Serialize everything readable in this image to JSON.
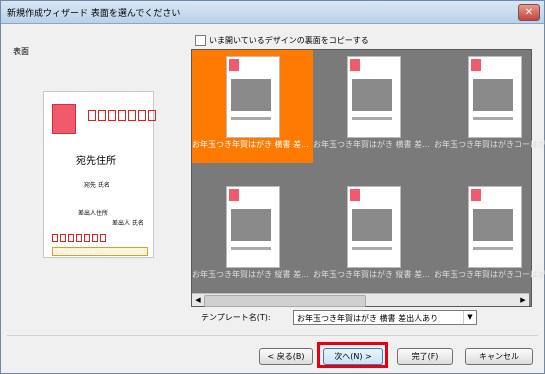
{
  "window": {
    "title": "新規作成ウィザード 表面を選んでください",
    "close_symbol": "✕"
  },
  "options": {
    "copy_open_design_label": "いま開いているデザインの裏面をコピーする"
  },
  "side_label": "表面",
  "preview": {
    "address": "宛先住所",
    "name": "宛先 氏名",
    "sender_address": "差出人住所",
    "sender_name": "差出人 氏名"
  },
  "templates": [
    {
      "label": "お年玉つき年賀はがき 横書 差..."
    },
    {
      "label": "お年玉つき年賀はがき 横書 差..."
    },
    {
      "label": "お年玉つき年賀はがきコーはが..."
    },
    {
      "label": "お年玉つき年賀はがき 縦書 差..."
    },
    {
      "label": "お年玉つき年賀はがき 縦書 差..."
    },
    {
      "label": "お年玉つき年賀はがきコーはが..."
    }
  ],
  "selected_template_index": 0,
  "template_name": {
    "label": "テンプレート名(T):",
    "value": "お年玉つき年賀はがき 横書 差出人あり"
  },
  "buttons": {
    "back": "< 戻る(B)",
    "next": "次へ(N) >",
    "finish": "完了(F)",
    "cancel": "キャンセル"
  },
  "colors": {
    "selected": "#ff7a00",
    "highlight": "#e60012",
    "stamp_red": "#f05a6a"
  }
}
